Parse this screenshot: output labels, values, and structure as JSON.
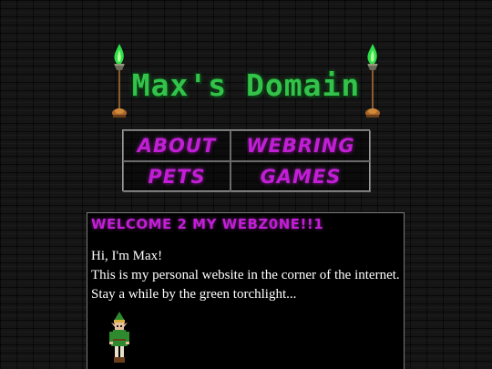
{
  "header": {
    "site_title": "Max's Domain"
  },
  "nav": {
    "items": [
      {
        "label": "ABOUT"
      },
      {
        "label": "WEBRING"
      },
      {
        "label": "PETS"
      },
      {
        "label": "GAMES"
      }
    ]
  },
  "panel": {
    "heading": "WELCOME 2 MY WEBZ0NE!!1",
    "lines": [
      "Hi, I'm Max!",
      "This is my personal website in the corner of the internet.",
      "Stay a while by the green torchlight..."
    ]
  },
  "colors": {
    "background": "#151515",
    "title_green": "#33c24a",
    "nav_magenta": "#c21ed6",
    "torch_flame": "#2ee04a",
    "panel_bg": "#000000"
  },
  "icons": {
    "left_torch": "green-torch-icon",
    "right_torch": "green-torch-icon",
    "character": "elf-character-sprite"
  }
}
